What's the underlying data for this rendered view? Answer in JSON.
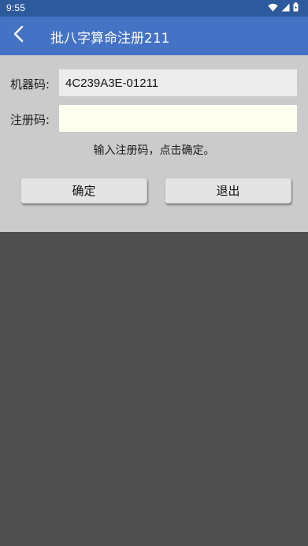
{
  "status_bar": {
    "time": "9:55",
    "icons": [
      "wifi-icon",
      "cell-signal-icon",
      "battery-icon"
    ]
  },
  "app_bar": {
    "back_icon": "chevron-left-icon",
    "title": "批八字算命注册211"
  },
  "form": {
    "machine_code_label": "机器码:",
    "machine_code_value": "4C239A3E-01211",
    "reg_code_label": "注册码:",
    "reg_code_value": "",
    "hint": "输入注册码，点击确定。"
  },
  "buttons": {
    "ok_label": "确定",
    "exit_label": "退出"
  },
  "colors": {
    "status_bar_bg": "#2d5a9c",
    "app_bar_bg": "#4472c4",
    "panel_bg": "#cbcbcb",
    "reg_field_bg": "#fffff0",
    "backdrop": "#505050"
  }
}
